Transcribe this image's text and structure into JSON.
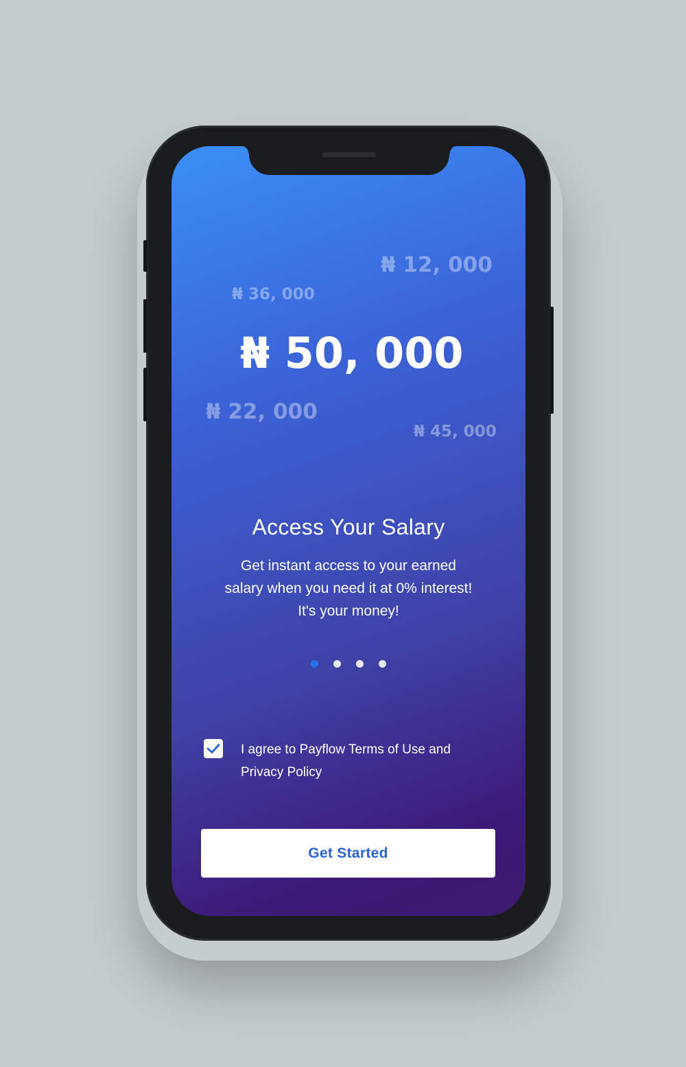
{
  "background_color": "#c5cdce",
  "colors": {
    "gradient_top": "#3a8ff7",
    "gradient_bottom": "#3d1b6e",
    "dot_active": "#2473e8",
    "button_text": "#2a63d6"
  },
  "amounts": {
    "floating": [
      {
        "id": "amt-12",
        "text": "₦ 12, 000"
      },
      {
        "id": "amt-36",
        "text": "₦ 36, 000"
      },
      {
        "id": "amt-22",
        "text": "₦ 22, 000"
      },
      {
        "id": "amt-45",
        "text": "₦ 45, 000"
      }
    ],
    "main": "₦ 50, 000"
  },
  "onboarding": {
    "title": "Access Your Salary",
    "description_lines": [
      "Get instant access to your earned",
      "salary when you need it at 0% interest!",
      "It's your money!"
    ],
    "page_indicator": {
      "total": 4,
      "active_index": 0
    }
  },
  "terms": {
    "checked": true,
    "checkbox_icon": "checkmark-icon",
    "lines": [
      "I agree to Payflow Terms of Use and",
      "Privacy Policy"
    ]
  },
  "cta": {
    "label": "Get Started"
  }
}
